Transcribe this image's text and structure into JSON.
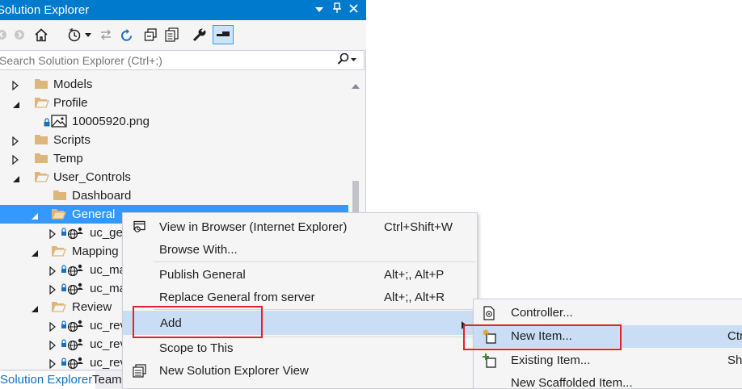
{
  "panel": {
    "title": "Solution Explorer",
    "title_controls": [
      "▼",
      "📌",
      "✕"
    ],
    "search_placeholder": "Search Solution Explorer (Ctrl+;)"
  },
  "toolbar": {
    "buttons": [
      "back-icon",
      "forward-icon",
      "home-icon",
      "history-icon",
      "dropdown-icon",
      "sync-icon",
      "refresh-icon",
      "collapse-all-icon",
      "show-all-files-icon",
      "properties-icon",
      "preview-icon"
    ]
  },
  "tree": {
    "items": [
      {
        "label": "Models"
      },
      {
        "label": "Profile"
      },
      {
        "label": "10005920.png"
      },
      {
        "label": "Scripts"
      },
      {
        "label": "Temp"
      },
      {
        "label": "User_Controls"
      },
      {
        "label": "Dashboard"
      },
      {
        "label": "General"
      },
      {
        "label": "uc_gen"
      },
      {
        "label": "Mapping"
      },
      {
        "label": "uc_map"
      },
      {
        "label": "uc_map"
      },
      {
        "label": "Review"
      },
      {
        "label": "uc_rev"
      },
      {
        "label": "uc_rev"
      },
      {
        "label": "uc_rev"
      }
    ]
  },
  "tabs": {
    "solution_explorer": "Solution Explorer",
    "team": "Team"
  },
  "context_menu": {
    "items": [
      {
        "label": "View in Browser (Internet Explorer)",
        "shortcut": "Ctrl+Shift+W"
      },
      {
        "label": "Browse With...",
        "shortcut": ""
      },
      {
        "label": "Publish General",
        "shortcut": "Alt+;, Alt+P"
      },
      {
        "label": "Replace General from server",
        "shortcut": "Alt+;, Alt+R"
      },
      {
        "label": "Add",
        "shortcut": ""
      },
      {
        "label": "Scope to This",
        "shortcut": ""
      },
      {
        "label": "New Solution Explorer View",
        "shortcut": ""
      }
    ]
  },
  "add_submenu": {
    "items": [
      {
        "label": "Controller...",
        "shortcut": ""
      },
      {
        "label": "New Item...",
        "shortcut": "Ctrl"
      },
      {
        "label": "Existing Item...",
        "shortcut": "Shi"
      },
      {
        "label": "New Scaffolded Item...",
        "shortcut": ""
      }
    ]
  },
  "colors": {
    "accent": "#007acc",
    "selection": "#3399ff",
    "menu_highlight": "#c9def5",
    "annotation": "#e0232e",
    "folder": "#dcb67a"
  }
}
